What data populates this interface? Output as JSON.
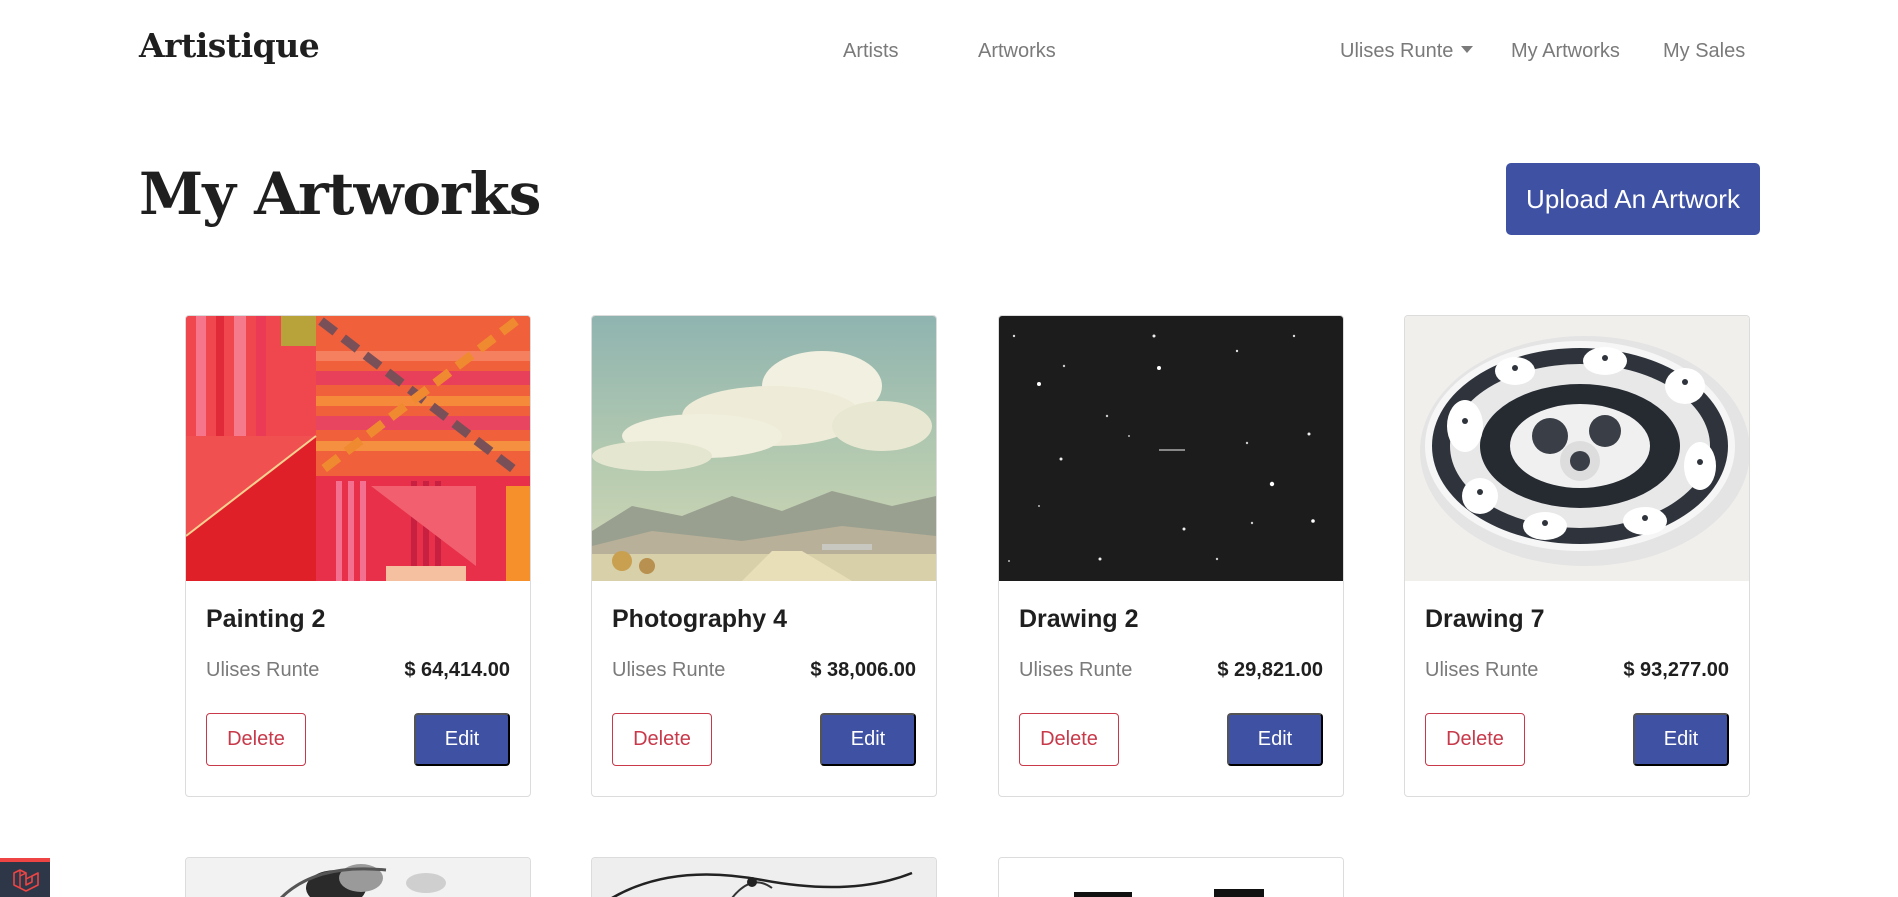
{
  "nav": {
    "brand": "Artistique",
    "artists": "Artists",
    "artworks": "Artworks",
    "user": "Ulises Runte",
    "my_artworks": "My Artworks",
    "my_sales": "My Sales"
  },
  "page": {
    "title": "My Artworks",
    "upload_label": "Upload An Artwork"
  },
  "artworks": [
    {
      "title": "Painting 2",
      "artist": "Ulises Runte",
      "price": "$ 64,414.00",
      "delete": "Delete",
      "edit": "Edit",
      "image": "red-geometric-painting"
    },
    {
      "title": "Photography 4",
      "artist": "Ulises Runte",
      "price": "$ 38,006.00",
      "delete": "Delete",
      "edit": "Edit",
      "image": "clouds-mountains-photo"
    },
    {
      "title": "Drawing 2",
      "artist": "Ulises Runte",
      "price": "$ 29,821.00",
      "delete": "Delete",
      "edit": "Edit",
      "image": "starry-night-drawing"
    },
    {
      "title": "Drawing 7",
      "artist": "Ulises Runte",
      "price": "$ 93,277.00",
      "delete": "Delete",
      "edit": "Edit",
      "image": "decorative-plate"
    }
  ],
  "colors": {
    "primary": "#3f51a3",
    "danger": "#c8394a",
    "muted": "#7a7a7a"
  }
}
